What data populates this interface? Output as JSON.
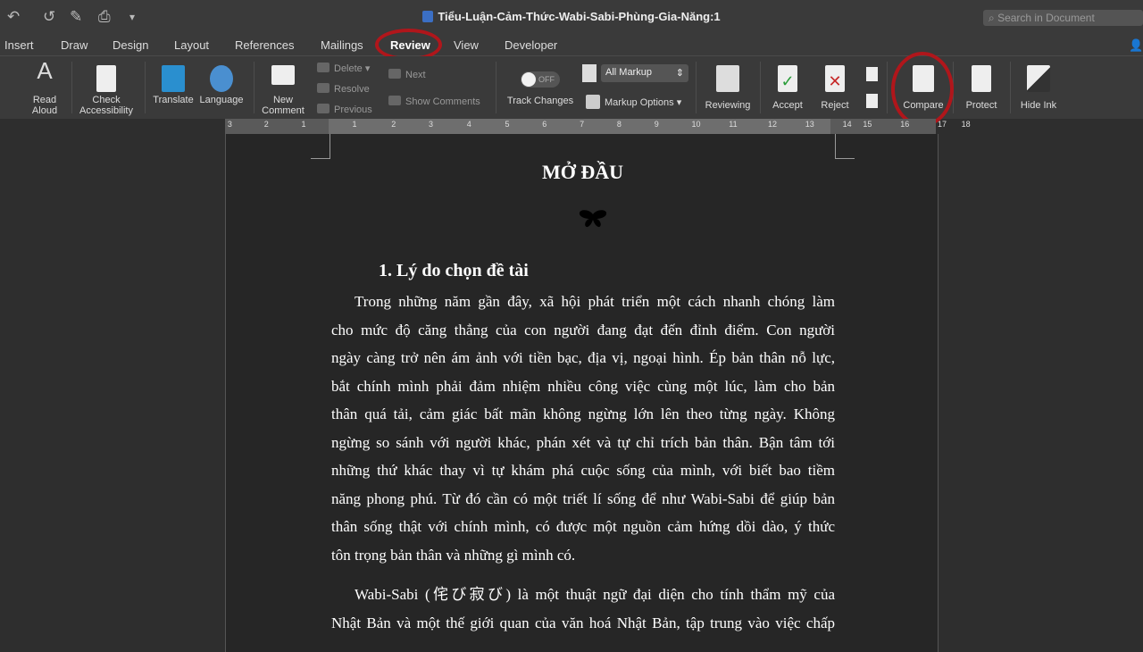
{
  "window": {
    "title": "Tiểu-Luận-Cảm-Thức-Wabi-Sabi-Phùng-Gia-Năng:1",
    "search_placeholder": "Search in Document"
  },
  "quick_access": {
    "undo": "↶",
    "redo": "↺",
    "edit": "✎",
    "print": "⎙",
    "more": "▾"
  },
  "tabs": [
    {
      "label": "Insert"
    },
    {
      "label": "Draw"
    },
    {
      "label": "Design"
    },
    {
      "label": "Layout"
    },
    {
      "label": "References"
    },
    {
      "label": "Mailings"
    },
    {
      "label": "Review",
      "active": true
    },
    {
      "label": "View"
    },
    {
      "label": "Developer"
    }
  ],
  "ribbon": {
    "read_aloud": [
      "Read",
      "Aloud"
    ],
    "check_accessibility": [
      "Check",
      "Accessibility"
    ],
    "translate": "Translate",
    "language": "Language",
    "new_comment": [
      "New",
      "Comment"
    ],
    "delete": "Delete",
    "resolve": "Resolve",
    "previous": "Previous",
    "next": "Next",
    "show_comments": "Show Comments",
    "track_changes": "Track Changes",
    "track_state": "OFF",
    "markup_select": "All Markup",
    "markup_options": "Markup Options",
    "reviewing": "Reviewing",
    "accept": "Accept",
    "reject": "Reject",
    "compare": "Compare",
    "protect": "Protect",
    "hide_ink": "Hide Ink"
  },
  "highlight_color": "#b0161b",
  "ruler": [
    "3",
    "2",
    "1",
    "1",
    "2",
    "3",
    "4",
    "5",
    "6",
    "7",
    "8",
    "9",
    "10",
    "11",
    "12",
    "13",
    "14",
    "15",
    "16",
    "17",
    "18"
  ],
  "document": {
    "heading": "MỞ ĐẦU",
    "ornament": "butterfly-icon",
    "section": "1. Lý do chọn đề tài",
    "para1": [
      "Trong những năm gần đây, xã hội phát triển một cách nhanh chóng làm",
      "cho mức độ căng thẳng của con người đang đạt đến đỉnh điểm. Con người",
      "ngày càng trở nên ám ảnh với tiền bạc, địa vị, ngoại hình. Ép bản thân nỗ lực,",
      "bắt chính mình phải đảm nhiệm nhiều công việc cùng một lúc, làm cho bản",
      "thân quá tải, cảm giác bất mãn không ngừng lớn lên theo từng ngày. Không",
      "ngừng so sánh với người khác, phán xét và tự chỉ trích bản thân. Bận tâm tới",
      "những thứ khác thay vì tự khám phá cuộc sống của mình, với biết bao tiềm",
      "năng phong phú. Từ đó cần có một triết lí sống để như Wabi-Sabi để giúp bản",
      "thân sống thật với chính mình, có được một nguồn cảm hứng dồi dào, ý thức",
      "tôn trọng bản thân và những gì mình có."
    ],
    "para2": [
      "Wabi-Sabi (侘び寂び) là một thuật ngữ đại diện cho tính thẩm mỹ của",
      "Nhật Bản và một thế giới quan của văn hoá Nhật Bản, tập trung vào việc chấp"
    ]
  }
}
